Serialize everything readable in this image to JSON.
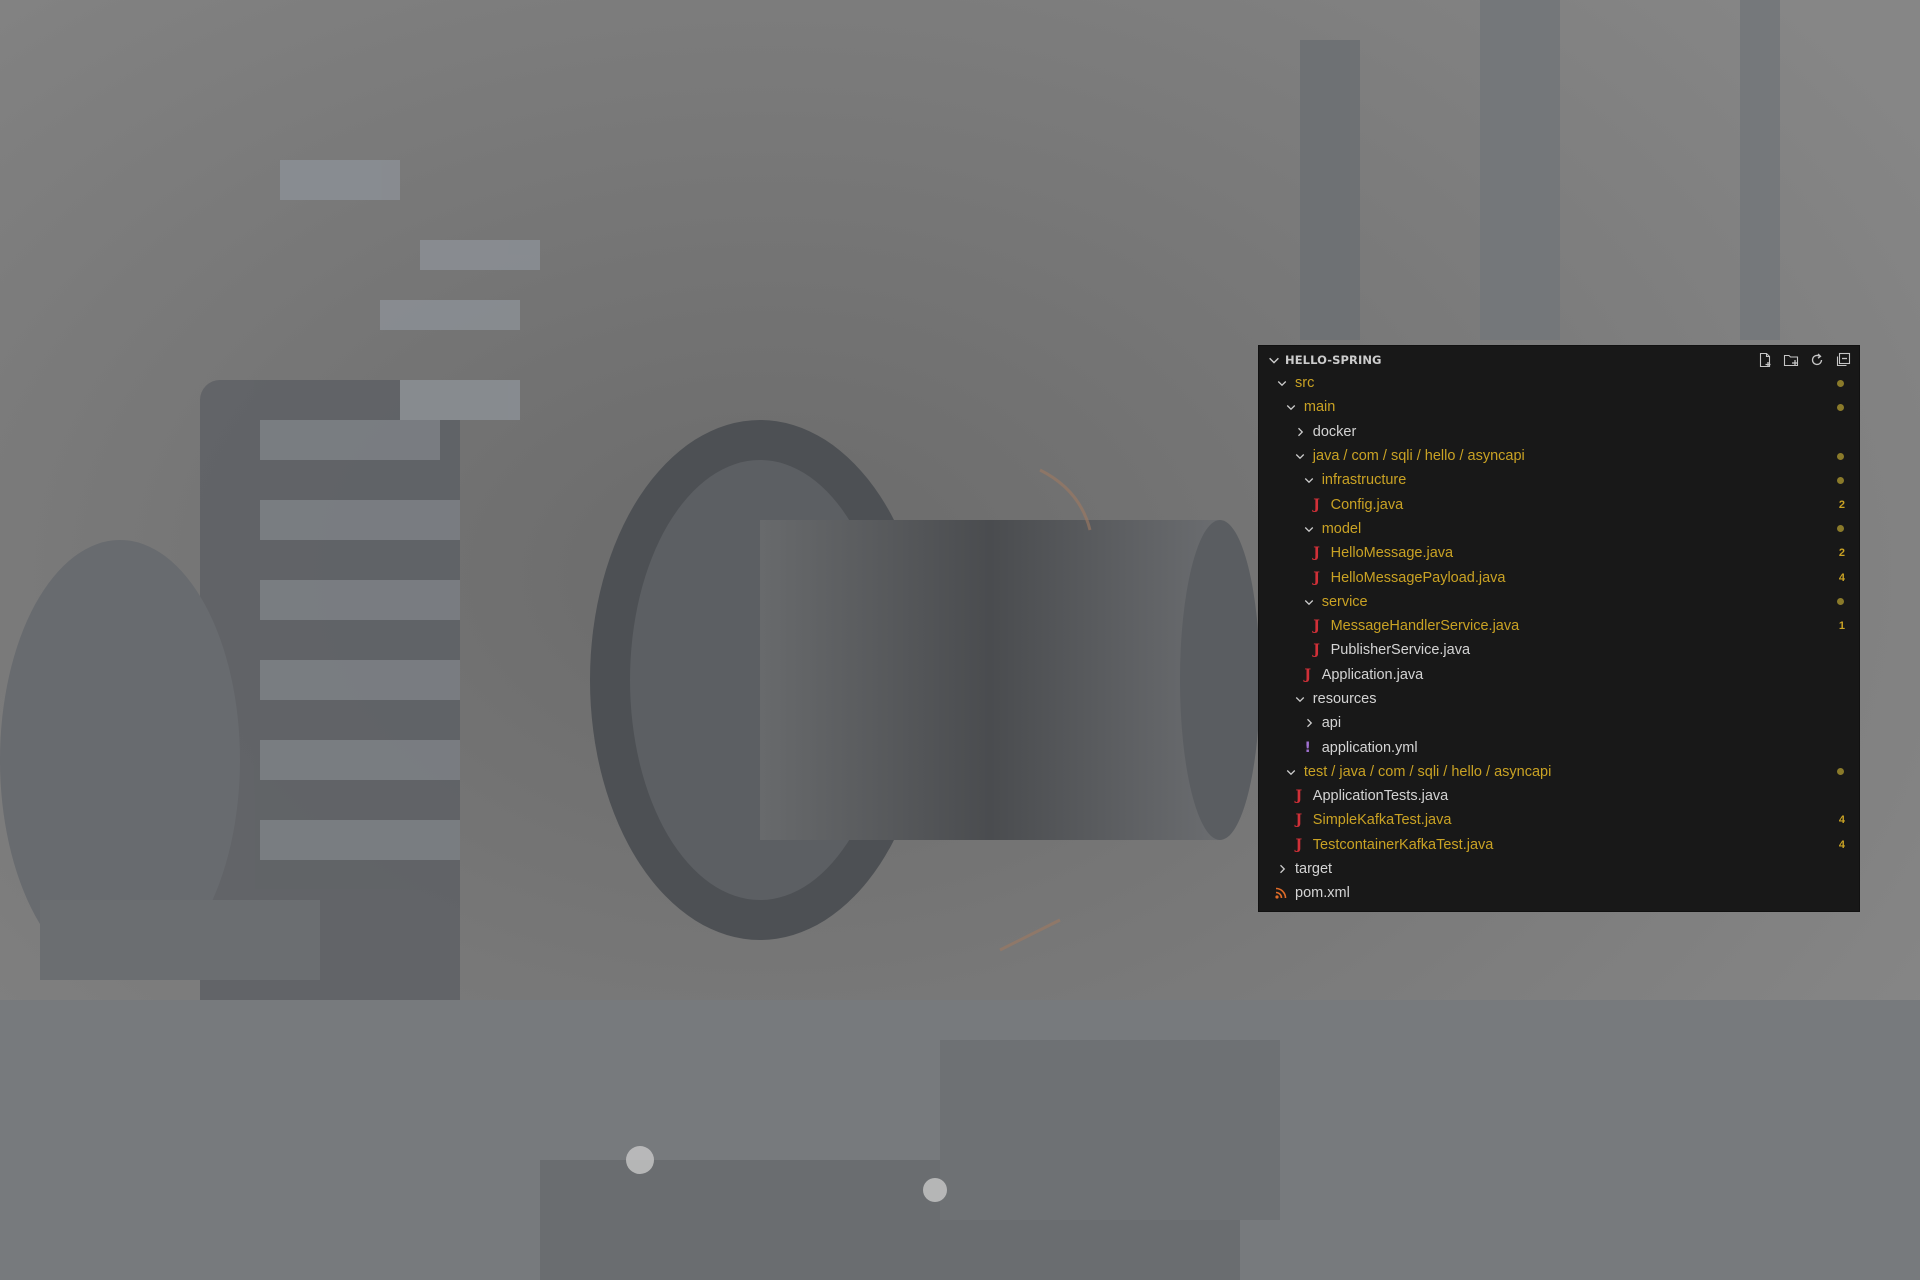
{
  "colors": {
    "panel_bg": "#181818",
    "modified_text": "#c9a224",
    "plain_text": "#d4d4d4",
    "java_icon": "#d03038",
    "yml_icon": "#a070d0",
    "xml_icon": "#e06c28",
    "decoration_dot": "#8a7a2a"
  },
  "explorer": {
    "title": "HELLO-SPRING",
    "actions": [
      {
        "name": "new-file-icon"
      },
      {
        "name": "new-folder-icon"
      },
      {
        "name": "refresh-icon"
      },
      {
        "name": "collapse-all-icon"
      }
    ],
    "tree": [
      {
        "label": "src",
        "type": "folder",
        "expanded": true,
        "depth": 0,
        "modified": true,
        "decoration": "dot"
      },
      {
        "label": "main",
        "type": "folder",
        "expanded": true,
        "depth": 1,
        "modified": true,
        "decoration": "dot"
      },
      {
        "label": "docker",
        "type": "folder",
        "expanded": false,
        "depth": 2,
        "modified": false,
        "decoration": ""
      },
      {
        "label": "java / com / sqli / hello / asyncapi",
        "type": "folder",
        "expanded": true,
        "depth": 2,
        "modified": true,
        "decoration": "dot"
      },
      {
        "label": "infrastructure",
        "type": "folder",
        "expanded": true,
        "depth": 3,
        "modified": true,
        "decoration": "dot"
      },
      {
        "label": "Config.java",
        "type": "java",
        "depth": 4,
        "modified": true,
        "decoration": "2"
      },
      {
        "label": "model",
        "type": "folder",
        "expanded": true,
        "depth": 3,
        "modified": true,
        "decoration": "dot"
      },
      {
        "label": "HelloMessage.java",
        "type": "java",
        "depth": 4,
        "modified": true,
        "decoration": "2"
      },
      {
        "label": "HelloMessagePayload.java",
        "type": "java",
        "depth": 4,
        "modified": true,
        "decoration": "4"
      },
      {
        "label": "service",
        "type": "folder",
        "expanded": true,
        "depth": 3,
        "modified": true,
        "decoration": "dot"
      },
      {
        "label": "MessageHandlerService.java",
        "type": "java",
        "depth": 4,
        "modified": true,
        "decoration": "1"
      },
      {
        "label": "PublisherService.java",
        "type": "java",
        "depth": 4,
        "modified": false,
        "decoration": ""
      },
      {
        "label": "Application.java",
        "type": "java",
        "depth": 3,
        "modified": false,
        "decoration": ""
      },
      {
        "label": "resources",
        "type": "folder",
        "expanded": true,
        "depth": 2,
        "modified": false,
        "decoration": ""
      },
      {
        "label": "api",
        "type": "folder",
        "expanded": false,
        "depth": 3,
        "modified": false,
        "decoration": ""
      },
      {
        "label": "application.yml",
        "type": "yml",
        "depth": 3,
        "modified": false,
        "decoration": ""
      },
      {
        "label": "test / java / com / sqli / hello / asyncapi",
        "type": "folder",
        "expanded": true,
        "depth": 1,
        "modified": true,
        "decoration": "dot"
      },
      {
        "label": "ApplicationTests.java",
        "type": "java",
        "depth": 2,
        "modified": false,
        "decoration": ""
      },
      {
        "label": "SimpleKafkaTest.java",
        "type": "java",
        "depth": 2,
        "modified": true,
        "decoration": "4"
      },
      {
        "label": "TestcontainerKafkaTest.java",
        "type": "java",
        "depth": 2,
        "modified": true,
        "decoration": "4"
      },
      {
        "label": "target",
        "type": "folder",
        "expanded": false,
        "depth": 0,
        "modified": false,
        "decoration": ""
      },
      {
        "label": "pom.xml",
        "type": "xml",
        "depth": 0,
        "modified": false,
        "decoration": ""
      }
    ]
  }
}
